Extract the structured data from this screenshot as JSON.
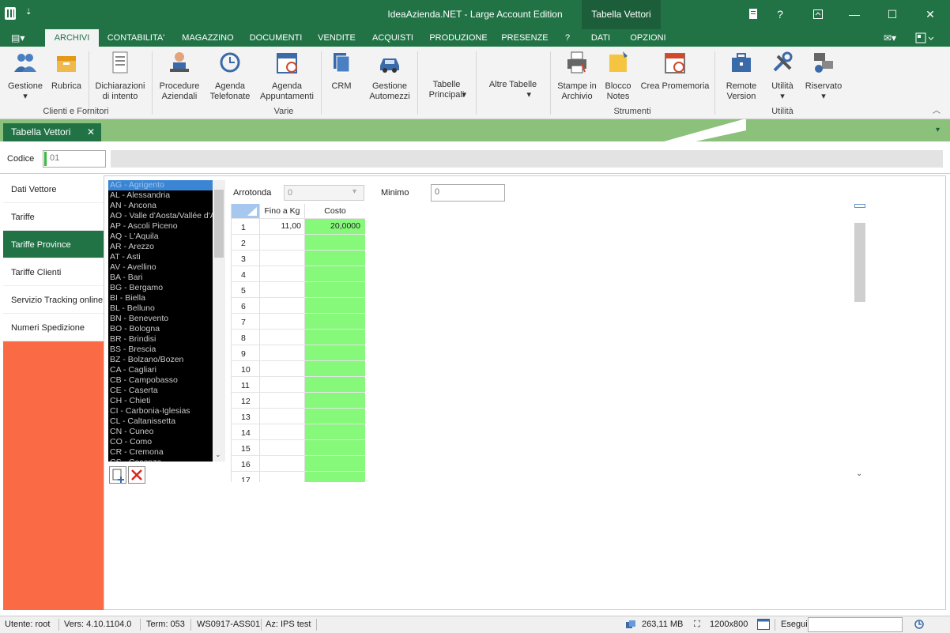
{
  "window": {
    "app_title": "IdeaAzienda.NET - Large Account Edition",
    "context_title": "Tabella Vettori"
  },
  "menu": [
    "ARCHIVI",
    "CONTABILITA'",
    "MAGAZZINO",
    "DOCUMENTI",
    "VENDITE",
    "ACQUISTI",
    "PRODUZIONE",
    "PRESENZE",
    "?",
    "DATI",
    "OPZIONI"
  ],
  "ribbon": {
    "buttons": {
      "gestione": "Gestione",
      "rubrica": "Rubrica",
      "dichiarazioni": "Dichiarazioni di intento",
      "procedure": "Procedure Aziendali",
      "agenda_tel": "Agenda Telefonate",
      "agenda_app": "Agenda Appuntamenti",
      "crm": "CRM",
      "automezzi": "Gestione Automezzi",
      "tabelle": "Tabelle Principali",
      "altre": "Altre Tabelle",
      "stampe": "Stampe in Archivio",
      "blocco": "Blocco Notes",
      "promemoria": "Crea Promemoria",
      "remote": "Remote Version",
      "utilita": "Utilità",
      "riservato": "Riservato"
    },
    "groups": {
      "clienti": "Clienti e Fornitori",
      "varie": "Varie",
      "strumenti": "Strumenti",
      "utilita": "Utilità"
    }
  },
  "doc_tab": {
    "label": "Tabella Vettori",
    "close": "✕"
  },
  "codice": {
    "label": "Codice",
    "value": "01"
  },
  "nav": [
    "Dati Vettore",
    "Tariffe",
    "Tariffe Province",
    "Tariffe Clienti",
    "Servizio Tracking online",
    "Numeri Spedizione"
  ],
  "provinces": [
    "AG - Agrigento",
    "AL - Alessandria",
    "AN - Ancona",
    "AO - Valle d'Aosta/Vallée d'Aoste",
    "AP - Ascoli Piceno",
    "AQ - L'Aquila",
    "AR - Arezzo",
    "AT - Asti",
    "AV - Avellino",
    "BA - Bari",
    "BG - Bergamo",
    "BI - Biella",
    "BL - Belluno",
    "BN - Benevento",
    "BO - Bologna",
    "BR - Brindisi",
    "BS - Brescia",
    "BZ - Bolzano/Bozen",
    "CA - Cagliari",
    "CB - Campobasso",
    "CE - Caserta",
    "CH - Chieti",
    "CI - Carbonia-Iglesias",
    "CL - Caltanissetta",
    "CN - Cuneo",
    "CO - Como",
    "CR - Cremona",
    "CS - Cosenza"
  ],
  "arrotonda": {
    "label": "Arrotonda",
    "value": "0"
  },
  "minimo": {
    "label": "Minimo",
    "value": "0"
  },
  "grid": {
    "headers": [
      "Fino a Kg",
      "Costo"
    ],
    "rows": [
      [
        "1",
        "11,00",
        "20,0000"
      ],
      [
        "2",
        "",
        ""
      ],
      [
        "3",
        "",
        ""
      ],
      [
        "4",
        "",
        ""
      ],
      [
        "5",
        "",
        ""
      ],
      [
        "6",
        "",
        ""
      ],
      [
        "7",
        "",
        ""
      ],
      [
        "8",
        "",
        ""
      ],
      [
        "9",
        "",
        ""
      ],
      [
        "10",
        "",
        ""
      ],
      [
        "11",
        "",
        ""
      ],
      [
        "12",
        "",
        ""
      ],
      [
        "13",
        "",
        ""
      ],
      [
        "14",
        "",
        ""
      ],
      [
        "15",
        "",
        ""
      ],
      [
        "16",
        "",
        ""
      ],
      [
        "17",
        "",
        ""
      ]
    ]
  },
  "status": {
    "utente": "Utente: root",
    "vers": "Vers: 4.10.1104.0",
    "term": "Term: 053",
    "ws": "WS0917-ASS01",
    "az": "Az: IPS test",
    "mem": "263,11 MB",
    "res": "1200x800",
    "esegui": "Esegui"
  }
}
